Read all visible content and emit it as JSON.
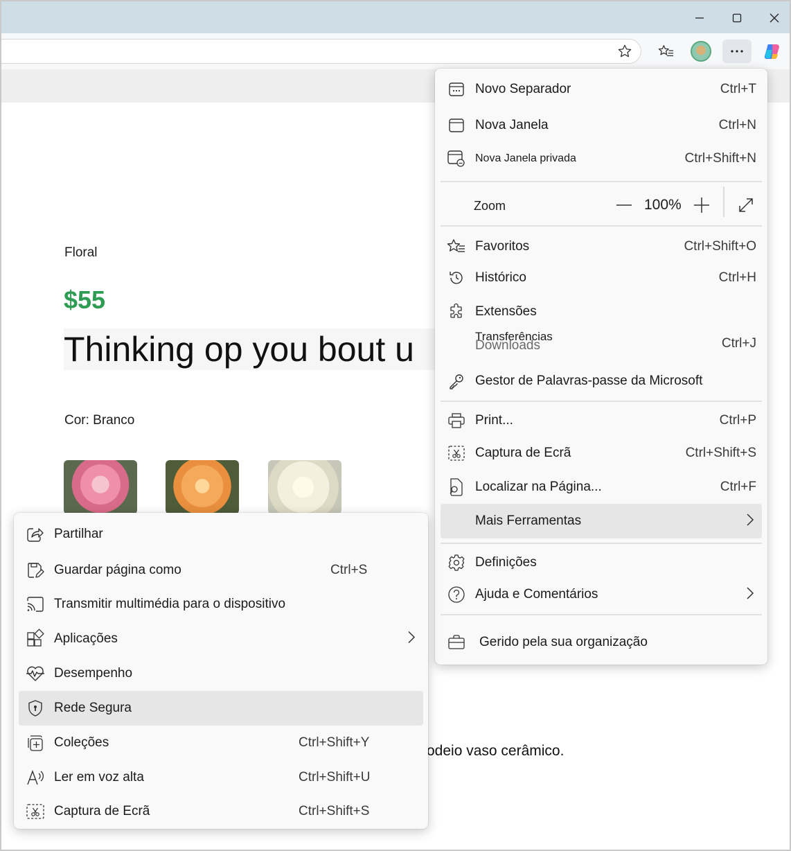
{
  "window": {
    "controls": {
      "minimize_icon": "minimize-icon",
      "maximize_icon": "maximize-icon",
      "close_icon": "close-icon"
    }
  },
  "toolbar": {
    "icons": [
      "star-icon",
      "favorites-icon",
      "profile-avatar",
      "more-icon",
      "copilot-icon"
    ]
  },
  "page": {
    "category": "Floral",
    "price": "$55",
    "product_title": "Thinking op you bout u",
    "color_label": "Cor: Branco",
    "swatches": [
      "pink",
      "orange",
      "white"
    ],
    "description_fragment": "odeio vaso cerâmico.",
    "price_color": "#2e9c52"
  },
  "main_menu": {
    "new_tab": {
      "label": "Novo Separador",
      "shortcut": "Ctrl+T"
    },
    "new_window": {
      "label": "Nova Janela",
      "shortcut": "Ctrl+N"
    },
    "new_private_window": {
      "label": "Nova Janela privada",
      "shortcut": "Ctrl+Shift+N"
    },
    "zoom": {
      "label": "Zoom",
      "value": "100%",
      "minus": "—",
      "plus": "+"
    },
    "favorites": {
      "label": "Favoritos",
      "shortcut": "Ctrl+Shift+O"
    },
    "history": {
      "label": "Histórico",
      "shortcut": "Ctrl+H"
    },
    "extensions": {
      "label": "Extensões"
    },
    "downloads": {
      "label_overlay": "Transferências",
      "label": "Downloads",
      "shortcut": "Ctrl+J"
    },
    "password_manager": {
      "label": "Gestor de Palavras-passe da Microsoft"
    },
    "print": {
      "label": "Print...",
      "shortcut": "Ctrl+P"
    },
    "screenshot": {
      "label": "Captura de Ecrã",
      "shortcut": "Ctrl+Shift+S"
    },
    "find": {
      "label": "Localizar na Página...",
      "shortcut": "Ctrl+F"
    },
    "more_tools": {
      "label": "Mais Ferramentas"
    },
    "settings": {
      "label": "Definições"
    },
    "help": {
      "label": "Ajuda e Comentários"
    },
    "managed": {
      "label": "Gerido pela sua organização"
    }
  },
  "sub_menu": {
    "share": {
      "label": "Partilhar"
    },
    "save_page": {
      "label": "Guardar página como",
      "shortcut": "Ctrl+S"
    },
    "cast": {
      "label": "Transmitir multimédia para o dispositivo"
    },
    "apps": {
      "label": "Aplicações"
    },
    "performance": {
      "label": "Desempenho"
    },
    "secure_network": {
      "label": "Rede Segura"
    },
    "collections": {
      "label": "Coleções",
      "shortcut": "Ctrl+Shift+Y"
    },
    "read_aloud": {
      "label": "Ler em voz alta",
      "shortcut": "Ctrl+Shift+U"
    },
    "screenshot": {
      "label": "Captura de Ecrã",
      "shortcut": "Ctrl+Shift+S"
    }
  }
}
